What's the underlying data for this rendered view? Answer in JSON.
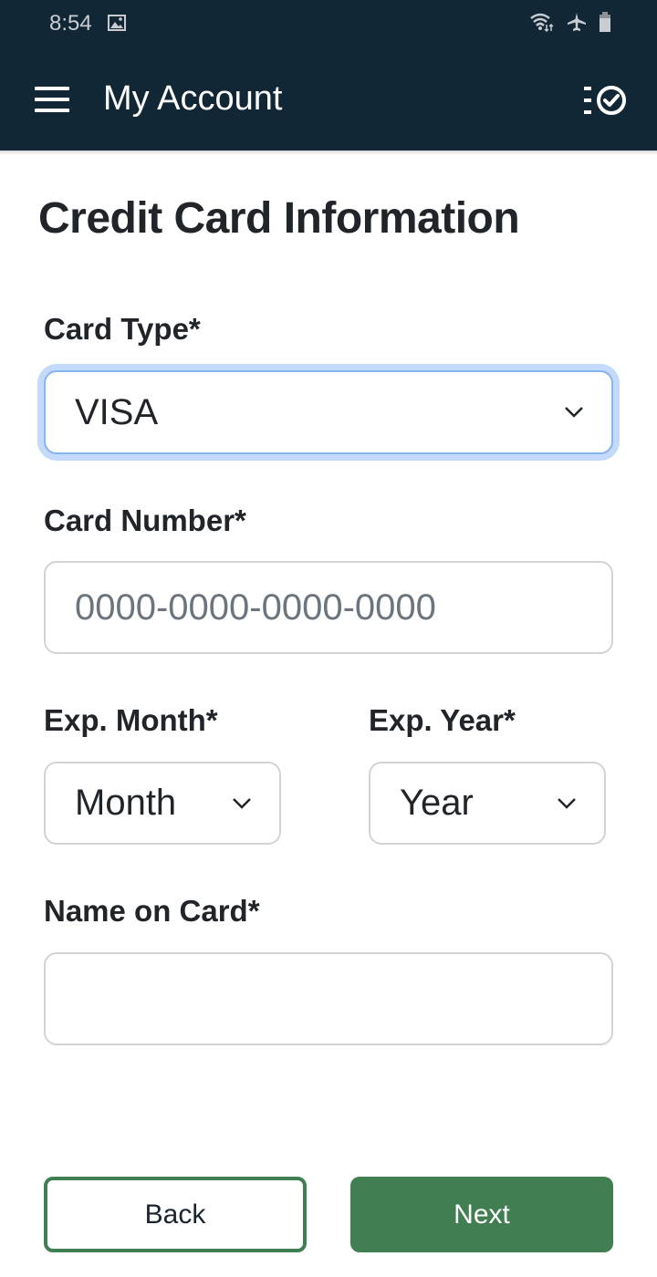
{
  "status_bar": {
    "time": "8:54",
    "left_icons": [
      "image-notification-icon"
    ],
    "right_icons": [
      "wifi-icon",
      "airplane-mode-icon",
      "battery-icon"
    ]
  },
  "app_bar": {
    "title": "My Account",
    "menu_icon": "hamburger-menu-icon",
    "action_icon": "checklist-icon"
  },
  "colors": {
    "app_bar_bg": "#122736",
    "primary_green": "#417f52",
    "focus_ring": "#c3dafc",
    "text_dark": "#212529",
    "placeholder": "#6c757d"
  },
  "form": {
    "title": "Credit Card Information",
    "card_type": {
      "label": "Card Type*",
      "selected": "VISA"
    },
    "card_number": {
      "label": "Card Number*",
      "value": "",
      "placeholder": "0000-0000-0000-0000"
    },
    "exp_month": {
      "label": "Exp. Month*",
      "selected": "Month"
    },
    "exp_year": {
      "label": "Exp. Year*",
      "selected": "Year"
    },
    "name_on_card": {
      "label": "Name on Card*",
      "value": "",
      "placeholder": ""
    }
  },
  "buttons": {
    "back": "Back",
    "next": "Next"
  }
}
